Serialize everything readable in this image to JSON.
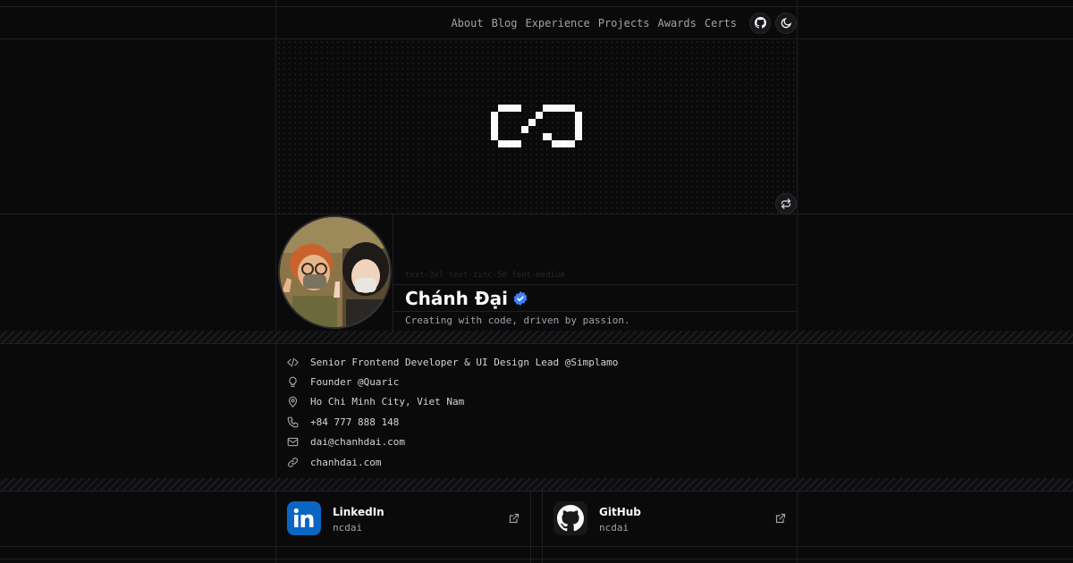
{
  "nav": {
    "links": [
      "About",
      "Blog",
      "Experience",
      "Projects",
      "Awards",
      "Certs"
    ],
    "github_icon": "github-icon",
    "theme_icon": "moon-icon"
  },
  "hero": {
    "logo_icon": "pixel-logo-icon",
    "swap_icon": "repeat-icon"
  },
  "profile": {
    "class_hint": "text-3xl text-zinc-50 font-medium",
    "name": "Chánh Đại",
    "verified_icon": "verified-badge-icon",
    "tagline": "Creating with code, driven by passion."
  },
  "info": [
    {
      "icon": "code-icon",
      "text": "Senior Frontend Developer & UI Design Lead @Simplamo"
    },
    {
      "icon": "lightbulb-icon",
      "text": "Founder @Quaric"
    },
    {
      "icon": "map-pin-icon",
      "text": "Ho Chi Minh City, Viet Nam"
    },
    {
      "icon": "phone-icon",
      "text": "+84 777 888 148"
    },
    {
      "icon": "mail-icon",
      "text": "dai@chanhdai.com"
    },
    {
      "icon": "link-icon",
      "text": "chanhdai.com"
    }
  ],
  "social": [
    {
      "title": "LinkedIn",
      "handle": "ncdai",
      "icon": "linkedin-icon",
      "color": "#0a66c2"
    },
    {
      "title": "GitHub",
      "handle": "ncdai",
      "icon": "github-icon",
      "color": "#18181b"
    }
  ],
  "colors": {
    "background": "#0a0a0b",
    "verified": "#3b82f6"
  }
}
